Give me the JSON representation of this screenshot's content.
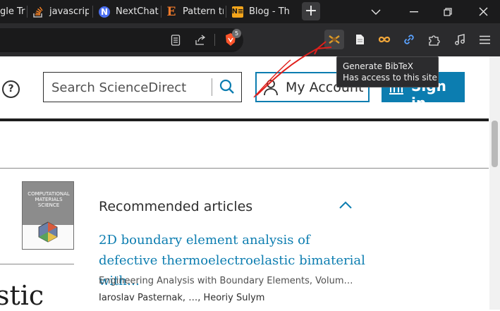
{
  "tabs": [
    {
      "label": "gle Tr",
      "icon": "google-icon"
    },
    {
      "label": "javascript",
      "icon": "stackoverflow-icon"
    },
    {
      "label": "NextChat",
      "icon": "nextchat-icon"
    },
    {
      "label": "Pattern tr",
      "icon": "pattern-e-icon"
    },
    {
      "label": "Blog - Th",
      "icon": "notion-blog-icon"
    }
  ],
  "new_tab_label": "+",
  "toolbar": {
    "brave_shield_count": "5",
    "extensions": [
      "bibtex-icon",
      "page-icon",
      "infinity-icon",
      "link-icon",
      "puzzle-icon",
      "music-icon",
      "menu-icon"
    ]
  },
  "tooltip": {
    "line1": "Generate BibTeX",
    "line2": "Has access to this site"
  },
  "header": {
    "help": "?",
    "search_placeholder": "Search ScienceDirect",
    "account_label": "My Account",
    "signin_label": "Sign in"
  },
  "journal_cover": {
    "title": "COMPUTATIONAL MATERIALS SCIENCE"
  },
  "recommended": {
    "heading": "Recommended articles",
    "articles": [
      {
        "title": "2D boundary element analysis of defective thermoelectroelastic bimaterial with…",
        "journal": "Engineering Analysis with Boundary Elements, Volum…",
        "authors": "Iaroslav Pasternak, …, Heoriy Sulym"
      }
    ]
  },
  "main_fragment": "stic",
  "colors": {
    "accent": "#0c7db0",
    "chrome_dark": "#1b1b1c",
    "annotation_red": "#e0201c"
  }
}
